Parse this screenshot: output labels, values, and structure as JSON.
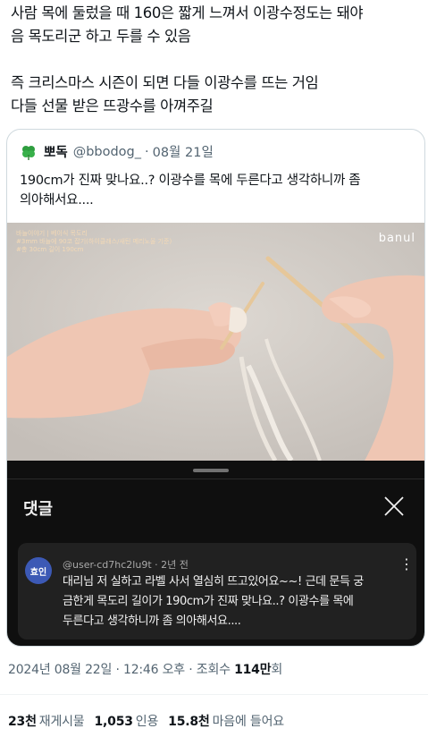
{
  "tweet": {
    "lines": [
      "사람 목에 둘렀을 때 160은 짧게 느껴서 이광수정도는 돼야",
      "음 목도리군 하고 두를 수 있음",
      "즉 크리스마스 시즌이 되면 다들 이광수를 뜨는 거임",
      "다들 선물 받은 뜨광수를 아껴주길"
    ]
  },
  "quote": {
    "author_name": "뽀독",
    "author_handle": "@bbodog_",
    "separator": "·",
    "date": "08월 21일",
    "avatar_icon": "clover-icon",
    "text_lines": [
      "190cm가 진짜 맞나요..? 이광수를 목에 두른다고 생각하니까 좀",
      "의아해서요...."
    ]
  },
  "video": {
    "overlay_lines": [
      "바늘이야기 | 베이식 목도리",
      "#3mm 바늘에 90코 잡기(하이클래스/새틴 메리노울 기준)",
      "#총 30cm 길이 190cm"
    ],
    "brand": "banul"
  },
  "comments_sheet": {
    "title": "댓글",
    "close_icon": "close-icon",
    "comment": {
      "avatar_text": "효인",
      "author": "@user-cd7hc2lu9t",
      "time": "2년 전",
      "more_icon": "more-vertical-icon",
      "text_lines": [
        "대리님 저 실하고 라벨 사서 열심히 뜨고있어요~~! 근데 문득 궁",
        "금한게 목도리 길이가 190cm가 진짜 맞나요..? 이광수를 목에",
        "두른다고 생각하니까 좀 의아해서요...."
      ]
    }
  },
  "meta": {
    "date": "2024년 08월 22일",
    "time": "12:46 오후",
    "views_label": "조회수",
    "views": "114만",
    "views_suffix": "회",
    "separator": "·"
  },
  "stats": [
    {
      "num": "23천",
      "label": "재게시물"
    },
    {
      "num": "1,053",
      "label": "인용"
    },
    {
      "num": "15.8천",
      "label": "마음에 들어요"
    }
  ],
  "colors": {
    "text": "#0f1419",
    "secondary": "#536471",
    "sheet_bg": "#0f0f0f",
    "comment_bg": "#212121",
    "avatar_bg": "#3c59b5"
  }
}
